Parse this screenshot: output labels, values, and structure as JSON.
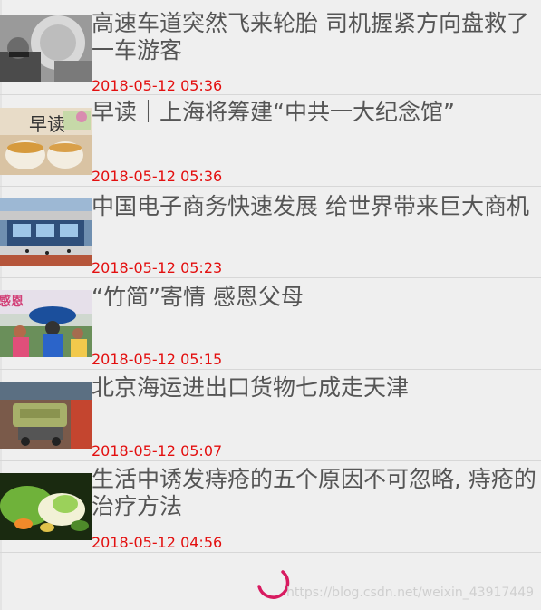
{
  "news": [
    {
      "title": "高速车道突然飞来轮胎 司机握紧方向盘救了一车游客",
      "time": "2018-05-12 05:36",
      "image": "driver-photo"
    },
    {
      "title": "早读｜上海将筹建“中共一大纪念馆”",
      "time": "2018-05-12 05:36",
      "image": "tea-cups-photo",
      "image_text": "早读"
    },
    {
      "title": "中国电子商务快速发展 给世界带来巨大商机",
      "time": "2018-05-12 05:23",
      "image": "expo-building-photo"
    },
    {
      "title": "“竹简”寄情 感恩父母",
      "time": "2018-05-12 05:15",
      "image": "crowd-photo",
      "image_text": "感恩"
    },
    {
      "title": "北京海运进出口货物七成走天津",
      "time": "2018-05-12 05:07",
      "image": "machinery-photo"
    },
    {
      "title": "生活中诱发痔疮的五个原因不可忽略, 痔疮的治疗方法",
      "time": "2018-05-12 04:56",
      "image": "vegetables-photo"
    }
  ],
  "loading": {
    "indicator": "loading-spinner-icon"
  },
  "watermark": "https://blog.csdn.net/weixin_43917449",
  "colors": {
    "title": "#555555",
    "time": "#e30f0f",
    "spinner": "#d81b60",
    "background": "#efefef"
  }
}
